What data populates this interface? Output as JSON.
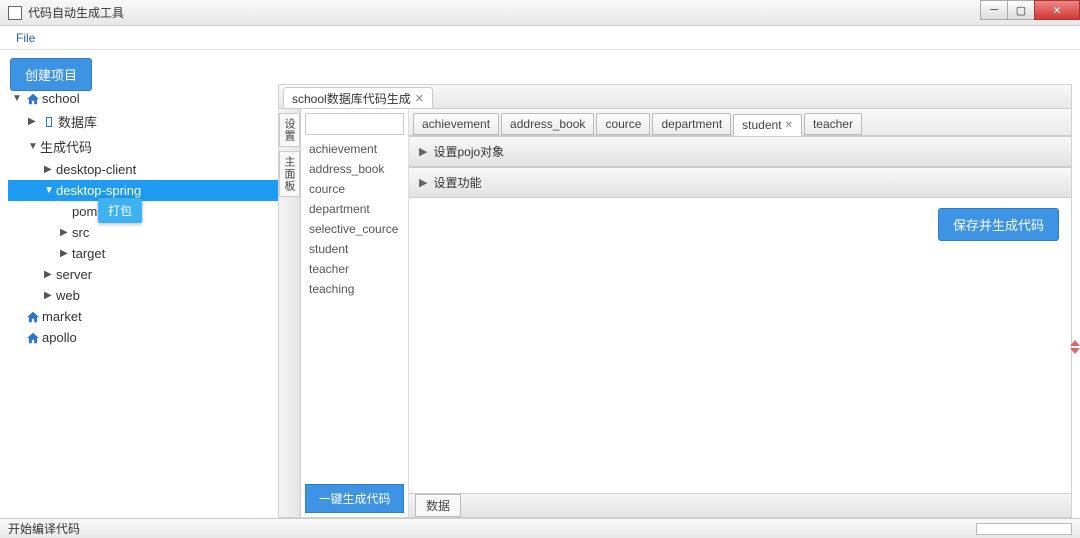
{
  "window": {
    "title": "代码自动生成工具"
  },
  "menubar": {
    "file": "File"
  },
  "toolbar": {
    "create_project": "创建项目"
  },
  "tree": {
    "school": "school",
    "database": "数据库",
    "gen_code": "生成代码",
    "desktop_client": "desktop-client",
    "desktop_spring": "desktop-spring",
    "pom_xml": "pom.xml",
    "src": "src",
    "target": "target",
    "server": "server",
    "web": "web",
    "market": "market",
    "apollo": "apollo"
  },
  "context_menu": {
    "pack": "打包"
  },
  "editor": {
    "tab_title": "school数据库代码生成",
    "side_tab_1": "设置",
    "side_tab_2": "主面板",
    "gen_button": "一键生成代码",
    "bottom_tab": "数据"
  },
  "entities": {
    "items": [
      "achievement",
      "address_book",
      "cource",
      "department",
      "selective_cource",
      "student",
      "teacher",
      "teaching"
    ]
  },
  "subtabs": {
    "items": [
      "achievement",
      "address_book",
      "cource",
      "department",
      "student",
      "teacher"
    ],
    "active": "student"
  },
  "accordion": {
    "pojo": "设置pojo对象",
    "func": "设置功能"
  },
  "buttons": {
    "save_gen": "保存并生成代码"
  },
  "status": {
    "text": "开始编译代码"
  }
}
